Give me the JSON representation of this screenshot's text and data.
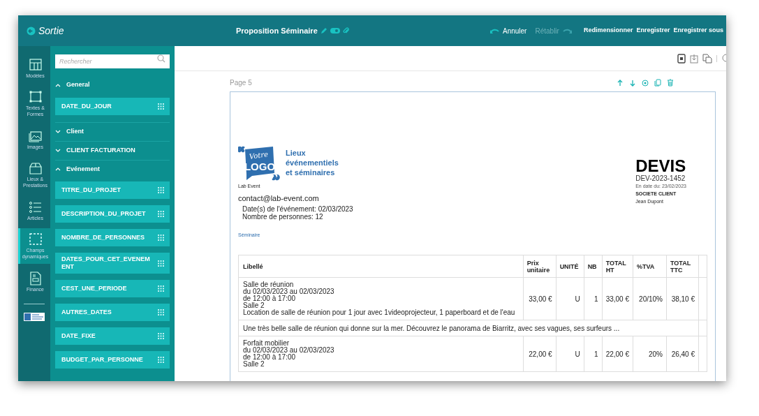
{
  "header": {
    "app_name": "Sortie",
    "document_title": "Proposition Séminaire",
    "history": [
      {
        "label": "Annuler",
        "kind": "undo",
        "disabled": false
      },
      {
        "label": "Rétablir",
        "kind": "redo",
        "disabled": true
      }
    ],
    "buttons": [
      "Redimensionner",
      "Enregistrer",
      "Enregistrer sous"
    ]
  },
  "rail": {
    "items": [
      {
        "label": "Modèles",
        "kind": "layout",
        "selected": false
      },
      {
        "label": "Textes & Formes",
        "kind": "shape",
        "selected": false
      },
      {
        "label": "Images",
        "kind": "image",
        "selected": false
      },
      {
        "label": "Lieux & Prestations",
        "kind": "box",
        "selected": false
      },
      {
        "label": "Articles",
        "kind": "list",
        "selected": false
      },
      {
        "label": "Champs dynamiques",
        "kind": "dashed",
        "selected": true
      },
      {
        "label": "Finance",
        "kind": "doc",
        "selected": false
      }
    ]
  },
  "sidebar": {
    "search": {
      "placeholder": "Rechercher"
    },
    "sections": [
      {
        "title": "General",
        "expanded": true,
        "fields": [
          "DATE_DU_JOUR"
        ]
      },
      {
        "title": "Client",
        "expanded": false
      },
      {
        "title": "CLIENT FACTURATION",
        "expanded": false
      },
      {
        "title": "Evénement",
        "expanded": true,
        "fields": [
          "TITRE_DU_PROJET",
          "DESCRIPTION_DU_PROJET",
          "NOMBRE_DE_PERSONNES",
          "DATES_POUR_CET_EVENEMENT",
          "CEST_UNE_PERIODE",
          "AUTRES_DATES",
          "DATE_FIXE",
          "BUDGET_PAR_PERSONNE"
        ]
      }
    ]
  },
  "page": {
    "label": "Page 5",
    "logo": {
      "top": "Votre",
      "bottom": "LOGO"
    },
    "tagline": [
      "Lieux",
      "événementiels",
      "et séminaires"
    ],
    "company": "Lab Event",
    "email": "contact@lab-event.com",
    "event_lines": [
      "Date(s) de l'événement: 02/03/2023",
      "Nombre de personnes: 12"
    ],
    "category": "Séminaire",
    "title": "DEVIS",
    "number": "DEV-2023-1452",
    "date": "En date du: 23/02/2023",
    "client_company": "SOCIETE CLIENT",
    "client_contact": "Jean Dupont",
    "table": {
      "columns": [
        "Libellé",
        "Prix unitaire",
        "UNITÉ",
        "NB",
        "TOTAL HT",
        "%TVA",
        "TOTAL TTC"
      ],
      "rows": [
        {
          "kind": "item",
          "label": [
            "Salle de réunion",
            "du 02/03/2023 au 02/03/2023",
            "de 12:00 à 17:00",
            "Salle 2",
            "Location de salle de réunion pour 1 jour avec 1videoprojecteur, 1 paperboard et de l'eau"
          ],
          "cells": [
            "33,00 €",
            "U",
            "1",
            "33,00 €",
            "20/10%",
            "38,10 €"
          ]
        },
        {
          "kind": "note",
          "text": "Une très belle salle de réunion qui donne sur la mer. Découvrez le panorama de Biarritz, avec ses vagues, ses surfeurs ..."
        },
        {
          "kind": "item",
          "label": [
            "Forfait mobilier",
            "du 02/03/2023 au 02/03/2023",
            "de 12:00 à 17:00",
            "Salle 2"
          ],
          "cells": [
            "22,00 €",
            "U",
            "1",
            "22,00 €",
            "20%",
            "26,40 €"
          ]
        }
      ]
    }
  }
}
